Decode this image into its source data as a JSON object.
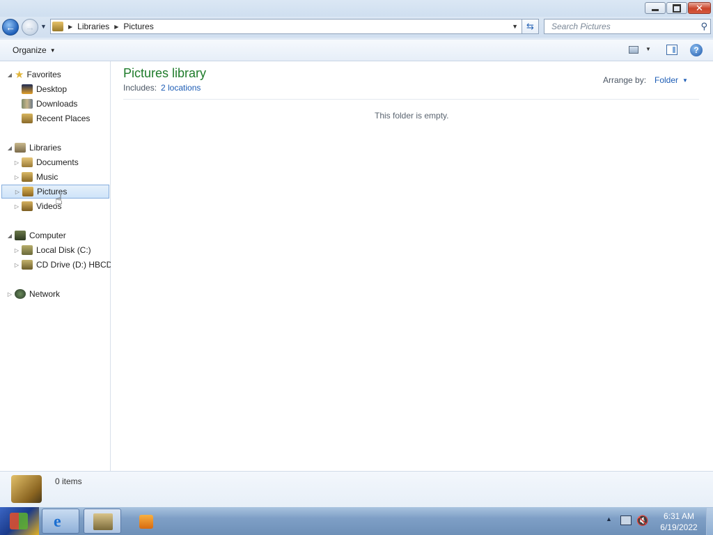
{
  "window": {
    "caption_buttons": [
      "minimize-icon",
      "restore-icon",
      "close-icon"
    ]
  },
  "address": {
    "crumbs": [
      "Libraries",
      "Pictures"
    ],
    "search_placeholder": "Search Pictures"
  },
  "toolbar": {
    "organize_label": "Organize"
  },
  "nav": {
    "favorites": {
      "label": "Favorites",
      "items": [
        "Desktop",
        "Downloads",
        "Recent Places"
      ]
    },
    "libraries": {
      "label": "Libraries",
      "items": [
        "Documents",
        "Music",
        "Pictures",
        "Videos"
      ]
    },
    "computer": {
      "label": "Computer",
      "items": [
        "Local Disk (C:)",
        "CD Drive (D:) HBCD_"
      ]
    },
    "network": {
      "label": "Network"
    },
    "selected": "Pictures"
  },
  "content": {
    "title": "Pictures library",
    "includes_label": "Includes:",
    "includes_link": "2 locations",
    "arrange_label": "Arrange by:",
    "arrange_value": "Folder",
    "empty_message": "This folder is empty."
  },
  "details": {
    "count": "0 items"
  },
  "taskbar": {
    "time": "6:31 AM",
    "date": "6/19/2022"
  },
  "colors": {
    "title_green": "#1e7b2a",
    "link_blue": "#1c5cb5",
    "selection": "#cfe4f9"
  }
}
